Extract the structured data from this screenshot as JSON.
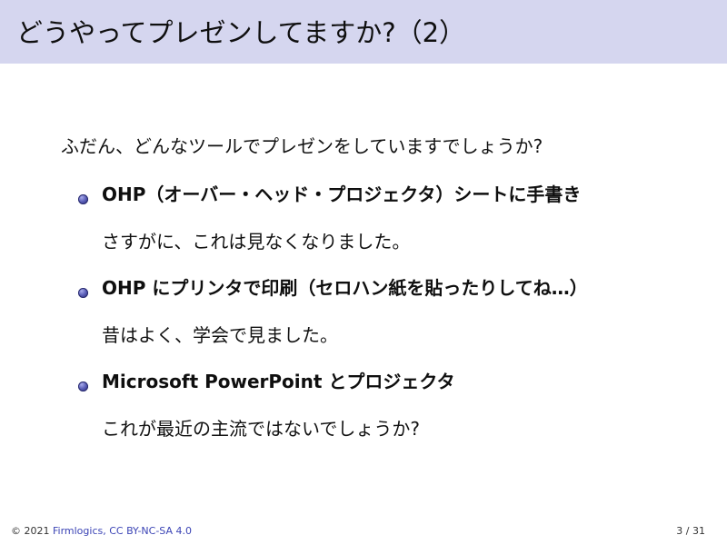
{
  "slide": {
    "title": "どうやってプレゼンしてますか?（2）",
    "intro": "ふだん、どんなツールでプレゼンをしていますでしょうか?",
    "bullets": [
      {
        "title": "OHP（オーバー・ヘッド・プロジェクタ）シートに手書き",
        "note": "さすがに、これは見なくなりました。"
      },
      {
        "title": "OHP にプリンタで印刷（セロハン紙を貼ったりしてね…）",
        "note": "昔はよく、学会で見ました。"
      },
      {
        "title": "Microsoft PowerPoint とプロジェクタ",
        "note": "これが最近の主流ではないでしょうか?"
      }
    ]
  },
  "footer": {
    "copyright_prefix": "© 2021 ",
    "link_text": "Firmlogics, CC BY-NC-SA 4.0",
    "page_indicator": "3 / 31"
  },
  "colors": {
    "title_bar": "#d5d6ef",
    "bullet": "#4b4fa8",
    "footer_link": "#3b44b5"
  },
  "icons": {
    "bullet_icon": "ball-bullet"
  }
}
